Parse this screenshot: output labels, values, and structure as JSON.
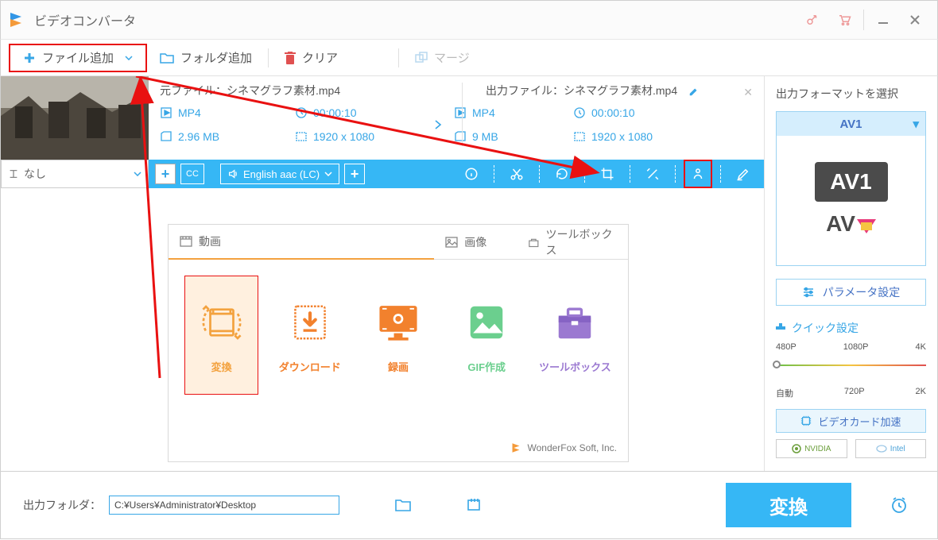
{
  "titlebar": {
    "title": "ビデオコンバータ"
  },
  "toolbar": {
    "add_file": "ファイル追加",
    "add_folder": "フォルダ追加",
    "clear": "クリア",
    "merge": "マージ"
  },
  "file": {
    "source_label": "元ファイル：",
    "source_name": "シネマグラフ素材.mp4",
    "output_label": "出力ファイル：",
    "output_name": "シネマグラフ素材.mp4",
    "src_format": "MP4",
    "src_duration": "00:00:10",
    "src_size": "2.96 MB",
    "src_res": "1920 x 1080",
    "out_format": "MP4",
    "out_duration": "00:00:10",
    "out_size": "9 MB",
    "out_res": "1920 x 1080"
  },
  "action_bar": {
    "subtitle_text": "なし",
    "audio_text": "English aac (LC)"
  },
  "modules": {
    "tab_video": "動画",
    "tab_image": "画像",
    "tab_toolbox": "ツールボックス",
    "card_convert": "変換",
    "card_download": "ダウンロード",
    "card_record": "録画",
    "card_gif": "GIF作成",
    "card_toolbox": "ツールボックス",
    "footer": "WonderFox Soft, Inc."
  },
  "right": {
    "title": "出力フォーマットを選択",
    "format_name": "AV1",
    "badge": "AV1",
    "logo": "AV",
    "param_btn": "パラメータ設定",
    "quick_title": "クイック設定",
    "labels_top": {
      "a": "480P",
      "b": "1080P",
      "c": "4K"
    },
    "labels_bot": {
      "a": "自動",
      "b": "720P",
      "c": "2K"
    },
    "gpu_btn": "ビデオカード加速",
    "nvidia": "NVIDIA",
    "intel": "Intel"
  },
  "bottom": {
    "label": "出力フォルダ：",
    "path": "C:¥Users¥Administrator¥Desktop",
    "convert": "変換"
  }
}
